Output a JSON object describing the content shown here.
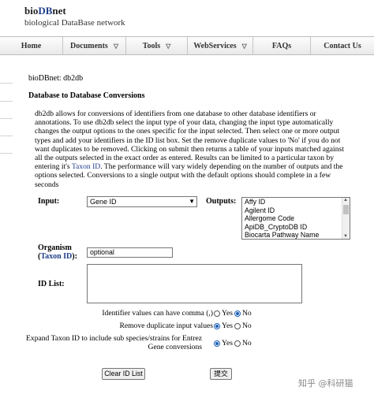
{
  "header": {
    "logo_prefix": "bio",
    "logo_db": "DB",
    "logo_suffix": "net",
    "subtitle": "biological DataBase network"
  },
  "nav": [
    {
      "label": "Home",
      "has_caret": false
    },
    {
      "label": "Documents",
      "has_caret": true
    },
    {
      "label": "Tools",
      "has_caret": true
    },
    {
      "label": "WebServices",
      "has_caret": true
    },
    {
      "label": "FAQs",
      "has_caret": false
    },
    {
      "label": "Contact Us",
      "has_caret": false
    }
  ],
  "breadcrumb": "bioDBnet: db2db",
  "section_title": "Database to Database Conversions",
  "description": {
    "part1": "db2db allows for conversions of identifiers from one database to other database identifiers or annotations. To use db2db select the input type of your data, changing the input type automatically changes the output options to the ones specific for the input selected. Then select one or more output types and add your identifiers in the ID list box. Set the remove duplicate values to 'No' if you do not want duplicates to be removed. Clicking on submit then returns a table of your inputs matched against all the outputs selected in the exact order as entered. Results can be limited to a particular taxon by entering it's ",
    "link": "Taxon ID",
    "part2": ". The performance will vary widely depending on the number of outputs and the options selected. Conversions to a single output with the default options should complete in a few seconds"
  },
  "form": {
    "input_label": "Input:",
    "input_selected": "Gene ID",
    "outputs_label": "Outputs:",
    "outputs_options": [
      "Affy ID",
      "Agilent ID",
      "Allergome Code",
      "ApiDB_CryptoDB ID",
      "Biocarta Pathway Name"
    ],
    "organism_label": "Organism",
    "organism_link_open": "(",
    "organism_link": "Taxon ID",
    "organism_link_close": "):",
    "organism_value": "optional",
    "idlist_label": "ID List:",
    "options": [
      {
        "label": "Identifier values can have comma (,)",
        "yes": "Yes",
        "no": "No",
        "selected": "No"
      },
      {
        "label": "Remove duplicate input values",
        "yes": "Yes",
        "no": "No",
        "selected": "Yes"
      },
      {
        "label": "Expand Taxon ID to include sub species/strains for Entrez Gene conversions",
        "yes": "Yes",
        "no": "No",
        "selected": "Yes"
      }
    ],
    "clear_button": "Clear ID List",
    "submit_button": "提交"
  },
  "watermark": "知乎 @科研猫"
}
